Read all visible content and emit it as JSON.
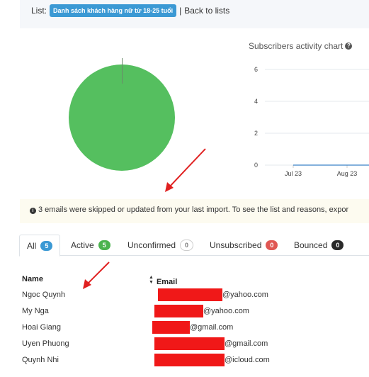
{
  "header": {
    "list_prefix": "List:",
    "list_name": "Danh sách khách hàng nữ từ 18-25 tuổi",
    "separator": "|",
    "back_label": "Back to lists"
  },
  "activity_chart": {
    "title": "Subscribers activity chart",
    "help_icon": "question-circle-icon"
  },
  "chart_data": [
    {
      "type": "pie",
      "slices": [
        {
          "value": 100,
          "color": "#55bf5f"
        }
      ]
    },
    {
      "type": "line",
      "x": [
        "Jul 23",
        "Aug 23"
      ],
      "y_ticks": [
        0,
        2,
        4,
        6
      ],
      "ylim": [
        0,
        6
      ],
      "series": [
        {
          "values": [
            0,
            0
          ],
          "color": "#3b82c8"
        }
      ],
      "grid": true
    }
  ],
  "notice": {
    "icon": "info-circle-icon",
    "text": "3 emails were skipped or updated from your last import. To see the list and reasons, expor"
  },
  "tabs": [
    {
      "label": "All",
      "count": "5",
      "color": "#3b99d4"
    },
    {
      "label": "Active",
      "count": "5",
      "color": "#4cb34f"
    },
    {
      "label": "Unconfirmed",
      "count": "0",
      "color": "#ffffff"
    },
    {
      "label": "Unsubscribed",
      "count": "0",
      "color": "#e05753"
    },
    {
      "label": "Bounced",
      "count": "0",
      "color": "#2a2a2a"
    }
  ],
  "table": {
    "columns": [
      "Name",
      "Email"
    ],
    "rows": [
      {
        "name": "Ngoc Quynh",
        "email_domain": "@yahoo.com"
      },
      {
        "name": "My Nga",
        "email_domain": "@yahoo.com"
      },
      {
        "name": "Hoai Giang",
        "email_domain": "@gmail.com"
      },
      {
        "name": "Uyen Phuong",
        "email_domain": "@gmail.com"
      },
      {
        "name": "Quynh Nhi",
        "email_domain": "@icloud.com"
      }
    ]
  },
  "annotations": {
    "arrow_color": "#e02020"
  }
}
